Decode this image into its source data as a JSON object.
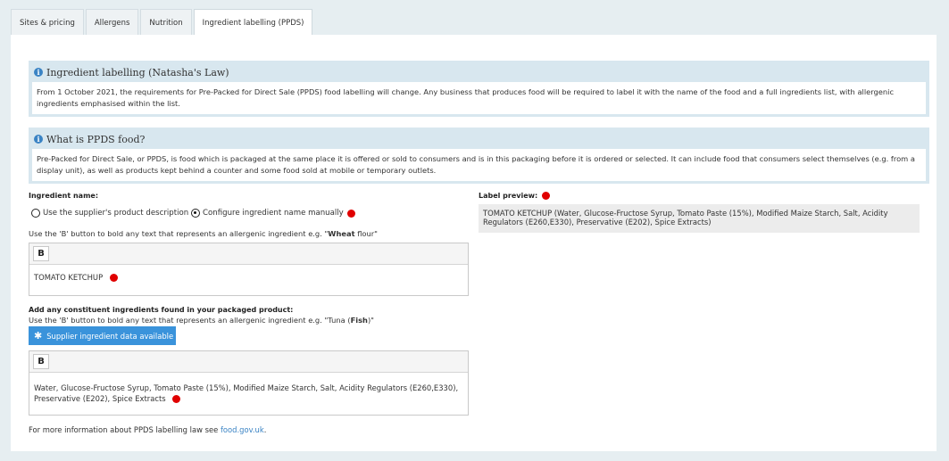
{
  "tabs": [
    {
      "label": "Sites & pricing",
      "active": false
    },
    {
      "label": "Allergens",
      "active": false
    },
    {
      "label": "Nutrition",
      "active": false
    },
    {
      "label": "Ingredient labelling (PPDS)",
      "active": true
    }
  ],
  "info_natasha": {
    "title": "Ingredient labelling (Natasha's Law)",
    "body": "From 1 October 2021, the requirements for Pre-Packed for Direct Sale (PPDS) food labelling will change. Any business that produces food will be required to label it with the name of the food and a full ingredients list, with allergenic ingredients emphasised within the list."
  },
  "info_ppds": {
    "title": "What is PPDS food?",
    "body": "Pre-Packed for Direct Sale, or PPDS, is food which is packaged at the same place it is offered or sold to consumers and is in this packaging before it is ordered or selected. It can include food that consumers select themselves (e.g. from a display unit), as well as products kept behind a counter and some food sold at mobile or temporary outlets."
  },
  "ingredient_name": {
    "label": "Ingredient name:",
    "option_supplier": "Use the supplier's product description",
    "option_manual": "Configure ingredient name manually",
    "selected": "manual",
    "hint_prefix": "Use the 'B' button to bold any text that represents an allergenic ingredient e.g. \"",
    "hint_bold": "Wheat",
    "hint_suffix": " flour\"",
    "editor_bold_button": "B",
    "value": "TOMATO KETCHUP"
  },
  "constituents": {
    "label": "Add any constituent ingredients found in your packaged product:",
    "hint_prefix": "Use the 'B' button to bold any text that represents an allergenic ingredient e.g. \"Tuna (",
    "hint_bold": "Fish",
    "hint_suffix": ")\"",
    "supplier_button": "Supplier ingredient data available",
    "editor_bold_button": "B",
    "value": "Water, Glucose-Fructose Syrup, Tomato Paste (15%), Modified Maize Starch, Salt, Acidity Regulators (E260,E330), Preservative (E202), Spice Extracts"
  },
  "label_preview": {
    "label": "Label preview:",
    "text": "TOMATO KETCHUP (Water, Glucose-Fructose Syrup, Tomato Paste (15%), Modified Maize Starch, Salt, Acidity Regulators (E260,E330), Preservative (E202), Spice Extracts)"
  },
  "footer": {
    "text": "For more information about PPDS labelling law see ",
    "link": "food.gov.uk",
    "suffix": "."
  },
  "colors": {
    "accent": "#3a93db",
    "info_bg": "#d8e7ef",
    "marker": "#e00000"
  },
  "icons": {
    "info": "info-circle-icon",
    "supplier": "asterisk-icon",
    "marker": "red-dot-marker"
  }
}
